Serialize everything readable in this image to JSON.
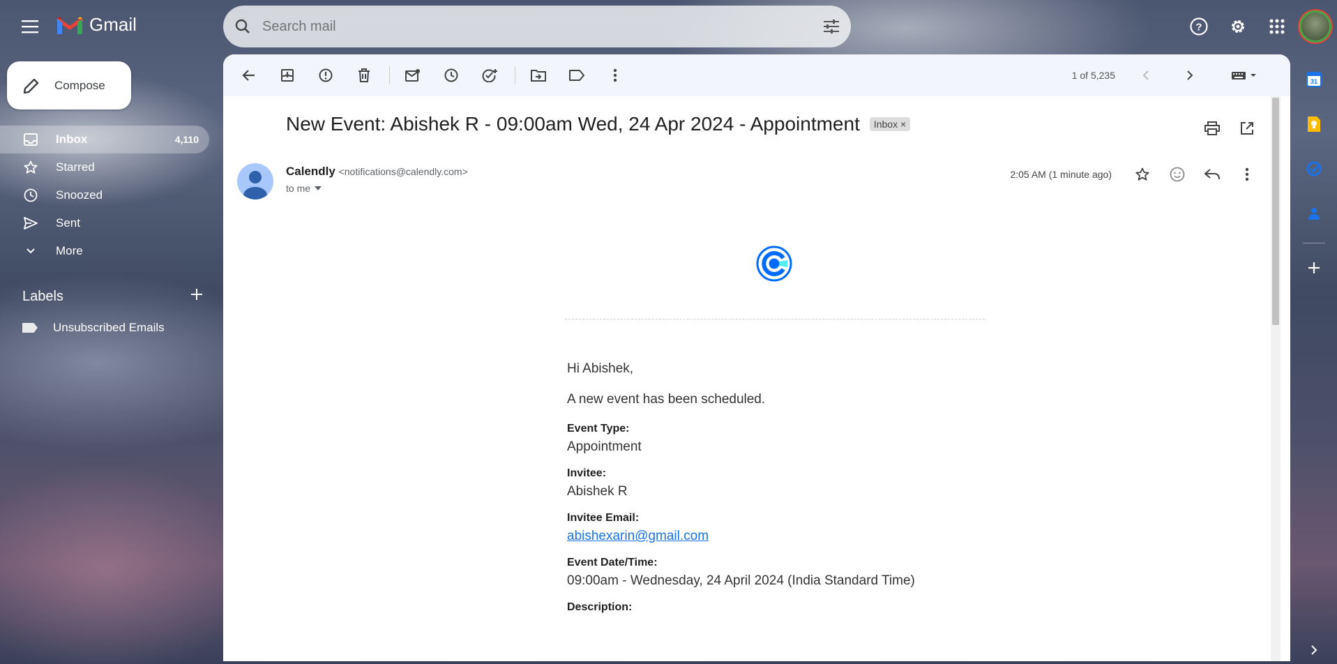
{
  "app": {
    "name": "Gmail"
  },
  "search": {
    "placeholder": "Search mail"
  },
  "compose": {
    "label": "Compose"
  },
  "nav": [
    {
      "label": "Inbox",
      "count": "4,110"
    },
    {
      "label": "Starred"
    },
    {
      "label": "Snoozed"
    },
    {
      "label": "Sent"
    },
    {
      "label": "More"
    }
  ],
  "labels": {
    "title": "Labels",
    "items": [
      {
        "label": "Unsubscribed Emails"
      }
    ]
  },
  "pager": {
    "text": "1 of 5,235"
  },
  "email": {
    "subject": "New Event: Abishek R - 09:00am Wed, 24 Apr 2024 - Appointment",
    "chip": "Inbox",
    "chip_close": "×",
    "sender_name": "Calendly",
    "sender_email": "<notifications@calendly.com>",
    "to": "to me",
    "time": "2:05 AM (1 minute ago)",
    "greeting": "Hi Abishek,",
    "intro": "A new event has been scheduled.",
    "fields": [
      {
        "label": "Event Type:",
        "value": "Appointment"
      },
      {
        "label": "Invitee:",
        "value": "Abishek R"
      },
      {
        "label": "Invitee Email:",
        "value": "abishexarin@gmail.com"
      },
      {
        "label": "Event Date/Time:",
        "value": "09:00am - Wednesday, 24 April 2024 (India Standard Time)"
      },
      {
        "label": "Description:",
        "value": ""
      }
    ]
  },
  "side_panel": {
    "calendar_day": "31"
  },
  "colors": {
    "calendar": "#1a73e8",
    "keep": "#fbbc04",
    "tasks": "#1a73e8",
    "contacts": "#1a73e8",
    "gmail_red": "#ea4335"
  }
}
